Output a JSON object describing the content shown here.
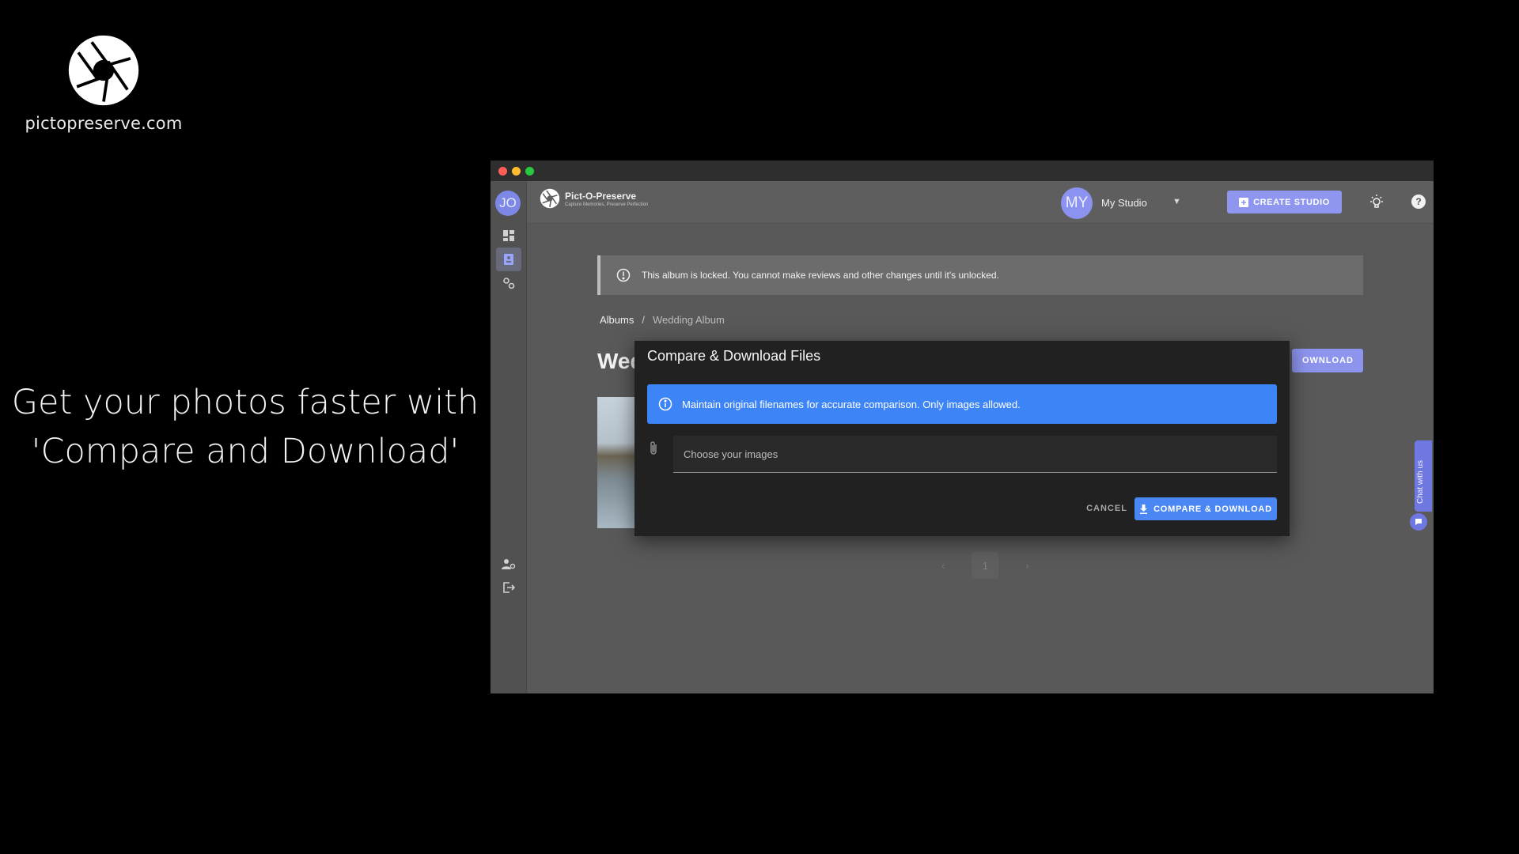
{
  "promo": {
    "brand_url": "pictopreserve.com",
    "tagline_line1": "Get your photos faster with",
    "tagline_line2": "'Compare and Download'"
  },
  "sidebar": {
    "user_initials": "JO",
    "items": [
      {
        "icon": "dashboard-icon"
      },
      {
        "icon": "album-icon",
        "active": true
      },
      {
        "icon": "settings-gears-icon"
      }
    ],
    "bottom_items": [
      {
        "icon": "user-settings-icon"
      },
      {
        "icon": "logout-icon"
      }
    ]
  },
  "appbar": {
    "app_name": "Pict-O-Preserve",
    "app_tagline": "Capture Memories, Preserve Perfection",
    "studio_initials": "MY",
    "studio_name": "My Studio",
    "create_label": "CREATE STUDIO"
  },
  "main": {
    "locked_message": "This album is locked. You cannot make reviews and other changes until it's unlocked.",
    "breadcrumb": [
      "Albums",
      "Wedding Album"
    ],
    "breadcrumb_separator": "/",
    "page_title_visible": "Wed",
    "download_partial": "OWNLOAD",
    "pagination": {
      "prev": "‹",
      "page": "1",
      "next": "›"
    }
  },
  "chat": {
    "label": "Chat with us"
  },
  "dialog": {
    "title": "Compare & Download Files",
    "info": "Maintain original filenames for accurate comparison. Only images allowed.",
    "file_placeholder": "Choose your images",
    "cancel_label": "CANCEL",
    "submit_label": "COMPARE & DOWNLOAD"
  },
  "colors": {
    "accent": "#8f96f0",
    "info_blue": "#3d84f6",
    "dialog_bg": "#212121"
  }
}
